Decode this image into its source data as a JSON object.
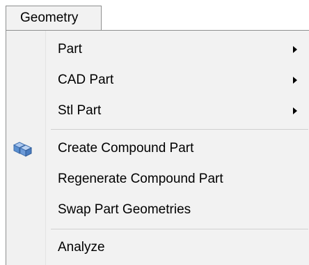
{
  "menubar": {
    "tab_label": "Geometry"
  },
  "menu": {
    "items": [
      {
        "label": "Part",
        "has_submenu": true
      },
      {
        "label": "CAD Part",
        "has_submenu": true
      },
      {
        "label": "Stl Part",
        "has_submenu": true
      },
      {
        "label": "Create Compound Part",
        "icon": "compound-part-icon"
      },
      {
        "label": "Regenerate Compound Part"
      },
      {
        "label": "Swap Part Geometries"
      },
      {
        "label": "Analyze"
      }
    ]
  },
  "colors": {
    "menu_background": "#f2f2f2",
    "border": "#8e8f8f",
    "separator": "#d0d0d0",
    "icon_blue": "#5a8fd0"
  }
}
